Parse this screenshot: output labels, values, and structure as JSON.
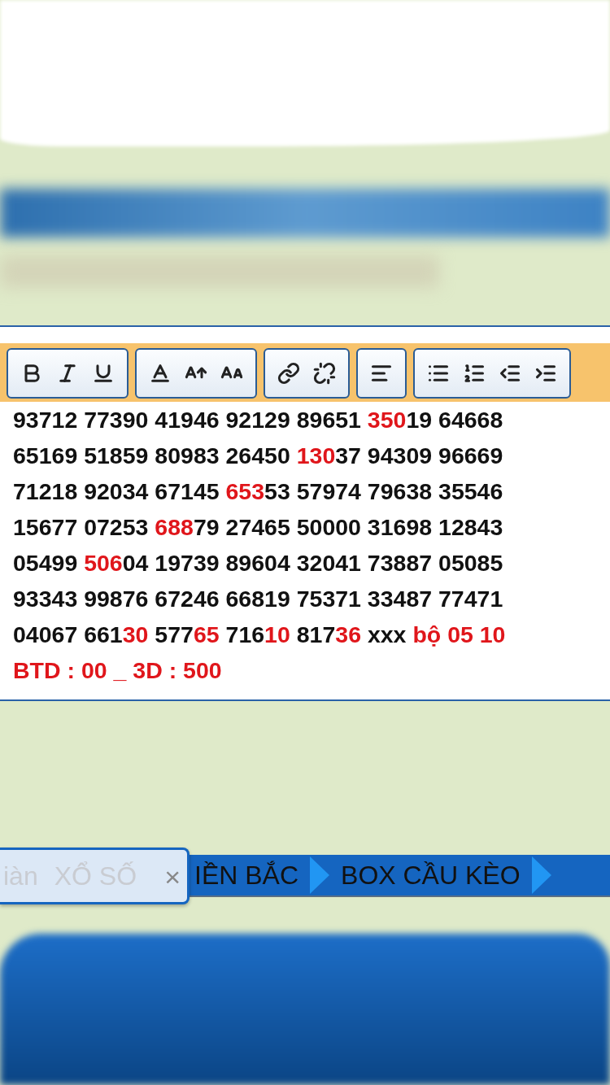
{
  "editor": {
    "lines": [
      [
        {
          "text": "93712 77390 41946 92129 89651 ",
          "highlight": false
        },
        {
          "text": "350",
          "highlight": true
        },
        {
          "text": "19 64668",
          "highlight": false
        }
      ],
      [
        {
          "text": "65169 51859 80983 26450 ",
          "highlight": false
        },
        {
          "text": "130",
          "highlight": true
        },
        {
          "text": "37 94309 96669",
          "highlight": false
        }
      ],
      [
        {
          "text": "71218 92034 67145 ",
          "highlight": false
        },
        {
          "text": "653",
          "highlight": true
        },
        {
          "text": "53 57974 79638 35546",
          "highlight": false
        }
      ],
      [
        {
          "text": "15677 07253 ",
          "highlight": false
        },
        {
          "text": "688",
          "highlight": true
        },
        {
          "text": "79 27465 50000 31698 12843",
          "highlight": false
        }
      ],
      [
        {
          "text": "05499 ",
          "highlight": false
        },
        {
          "text": "506",
          "highlight": true
        },
        {
          "text": "04 19739 89604 32041 73887 05085",
          "highlight": false
        }
      ],
      [
        {
          "text": "93343 99876 67246 66819 75371 33487 77471",
          "highlight": false
        }
      ],
      [
        {
          "text": "04067 661",
          "highlight": false
        },
        {
          "text": "30",
          "highlight": true
        },
        {
          "text": " 577",
          "highlight": false
        },
        {
          "text": "65",
          "highlight": true
        },
        {
          "text": " 716",
          "highlight": false
        },
        {
          "text": "10",
          "highlight": true
        },
        {
          "text": " 817",
          "highlight": false
        },
        {
          "text": "36",
          "highlight": true
        },
        {
          "text": " xxx ",
          "highlight": false
        },
        {
          "text": "bộ 05 10",
          "highlight": true
        }
      ],
      [
        {
          "text": "BTD : 00 _ 3D : 500",
          "highlight": true
        }
      ]
    ]
  },
  "popup": {
    "covered_items": [
      "iàn",
      "XỔ SỐ"
    ],
    "close": "×"
  },
  "breadcrumb": [
    "IỀN BẮC",
    "BOX CẦU KÈO"
  ]
}
